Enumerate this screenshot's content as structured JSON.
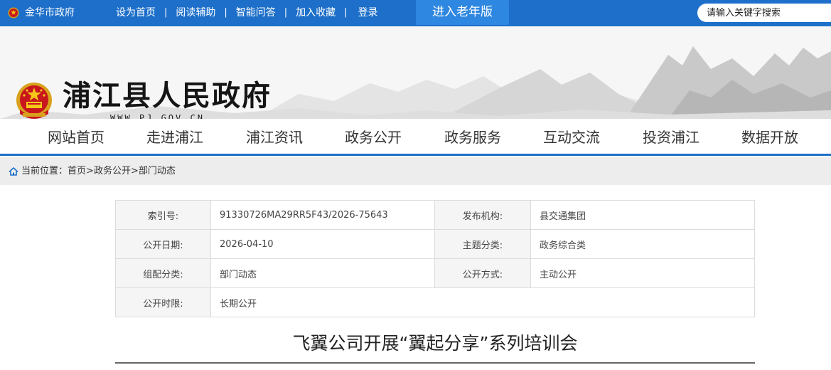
{
  "topbar": {
    "city_site": "金华市政府",
    "links": [
      "设为首页",
      "阅读辅助",
      "智能问答",
      "加入收藏"
    ],
    "separator": "|",
    "login": "登录",
    "elder_mode": "进入老年版",
    "search_placeholder": "请输入关键字搜索",
    "bg_color": "#1d6fc9"
  },
  "banner": {
    "site_title": "浦江县人民政府",
    "domain": "WWW.PJ.GOV.CN",
    "emblem_icon": "national-emblem-icon"
  },
  "nav": {
    "items": [
      "网站首页",
      "走进浦江",
      "浦江资讯",
      "政务公开",
      "政务服务",
      "互动交流",
      "投资浦江",
      "数据开放"
    ]
  },
  "breadcrumb": {
    "label": "当前位置：",
    "items": [
      "首页",
      "政务公开",
      "部门动态"
    ],
    "sep": ">",
    "icon": "home-icon"
  },
  "info": {
    "index_no_label": "索引号:",
    "index_no": "91330726MA29RR5F43/2026-75643",
    "publisher_label": "发布机构:",
    "publisher": "县交通集团",
    "pub_date_label": "公开日期:",
    "pub_date": "2026-04-10",
    "topic_label": "主题分类:",
    "topic": "政务综合类",
    "category_label": "组配分类:",
    "category": "部门动态",
    "method_label": "公开方式:",
    "method": "主动公开",
    "period_label": "公开时限:",
    "period": "长期公开"
  },
  "article": {
    "title": "飞翼公司开展“翼起分享”系列培训会"
  }
}
